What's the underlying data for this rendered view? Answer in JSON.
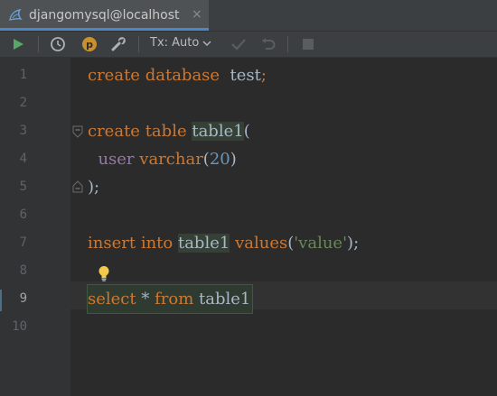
{
  "tab": {
    "title": "djangomysql@localhost",
    "close": "×"
  },
  "toolbar": {
    "tx_label": "Tx: Auto"
  },
  "icons": {
    "tab_icon": "database-dolphin-icon",
    "run": "run-icon",
    "history": "clock-icon",
    "profile": "p-badge-icon",
    "settings": "wrench-icon",
    "dropdown": "chevron-down-icon",
    "commit": "check-icon",
    "rollback": "undo-icon",
    "stop": "stop-icon",
    "intention": "lightbulb-icon"
  },
  "colors": {
    "keyword": "#cc7832",
    "identifier": "#a9b7c6",
    "column": "#9876aa",
    "number": "#6897bb",
    "string": "#6a8759",
    "background": "#2b2b2b"
  },
  "lines": [
    "1",
    "2",
    "3",
    "4",
    "5",
    "6",
    "7",
    "8",
    "9",
    "10"
  ],
  "code": {
    "l1": {
      "kw1": "create",
      "kw2": "database",
      "name": "test",
      "semi": ";"
    },
    "l3": {
      "kw1": "create",
      "kw2": "table",
      "name": "table1",
      "paren": "("
    },
    "l4": {
      "col": "user",
      "type": "varchar",
      "open": "(",
      "num": "20",
      "close": ")"
    },
    "l5": {
      "text": ");"
    },
    "l7": {
      "kw1": "insert",
      "kw2": "into",
      "name": "table1",
      "kw3": "values",
      "open": "(",
      "str": "'value'",
      "close": ");"
    },
    "l9": {
      "kw1": "select",
      "star": "*",
      "kw2": "from",
      "name": "table1"
    }
  }
}
